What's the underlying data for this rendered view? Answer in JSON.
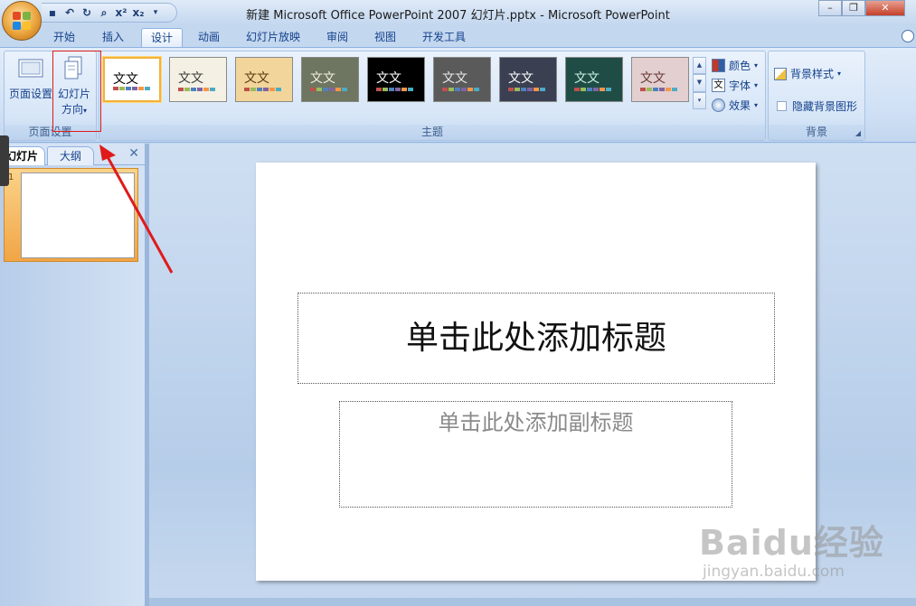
{
  "window": {
    "title": "新建 Microsoft Office PowerPoint 2007 幻灯片.pptx - Microsoft PowerPoint",
    "buttons": [
      "minimize-icon",
      "restore-icon",
      "close-icon"
    ]
  },
  "qat": {
    "items": [
      "save-icon",
      "undo-icon",
      "redo-icon",
      "print-preview-icon",
      "superscript-icon",
      "subscript-icon",
      "customize-qat-icon"
    ],
    "superscript": "x²",
    "subscript": "x₂"
  },
  "tabs": [
    "开始",
    "插入",
    "设计",
    "动画",
    "幻灯片放映",
    "审阅",
    "视图",
    "开发工具"
  ],
  "active_tab": "设计",
  "ribbon": {
    "page_setup_group": {
      "label": "页面设置",
      "page_setup_button": "页面设置",
      "orientation_button_line1": "幻灯片",
      "orientation_button_line2": "方向",
      "orientation_arrow": "▾"
    },
    "themes_group": {
      "label": "主题",
      "thumb_text": "文文",
      "themes": [
        {
          "bg": "#ffffff",
          "fg": "#000000",
          "selected": true
        },
        {
          "bg": "#f4f1e4",
          "fg": "#3b3b3b",
          "selected": false
        },
        {
          "bg": "#f2d59a",
          "fg": "#5a3b16",
          "selected": false
        },
        {
          "bg": "#6e7560",
          "fg": "#f0f0e0",
          "selected": false
        },
        {
          "bg": "#000000",
          "fg": "#ffffff",
          "selected": false
        },
        {
          "bg": "#5a5a5a",
          "fg": "#e8e8e8",
          "selected": false
        },
        {
          "bg": "#3a3f52",
          "fg": "#ffffff",
          "selected": false
        },
        {
          "bg": "#1f4d46",
          "fg": "#c8f0e0",
          "selected": false
        },
        {
          "bg": "#e3cfcf",
          "fg": "#6a3a3a",
          "selected": false
        }
      ],
      "colors_label": "颜色",
      "fonts_label": "字体",
      "effects_label": "效果",
      "dropdown_arrow": "▾"
    },
    "background_group": {
      "label": "背景",
      "bg_styles_label": "背景样式",
      "hide_bg_label": "隐藏背景图形",
      "hide_bg_checked": false,
      "dropdown_arrow": "▾"
    }
  },
  "left_pane": {
    "tab_slides": "幻灯片",
    "tab_outline": "大纲",
    "close": "✕",
    "slide_number": "1"
  },
  "slide": {
    "title_placeholder": "单击此处添加标题",
    "subtitle_placeholder": "单击此处添加副标题"
  },
  "watermark": {
    "line1": "Baidu经验",
    "line2": "jingyan.baidu.com"
  },
  "colors": {
    "accent_red": "#e01a1a",
    "ribbon_blue": "#15428b"
  }
}
